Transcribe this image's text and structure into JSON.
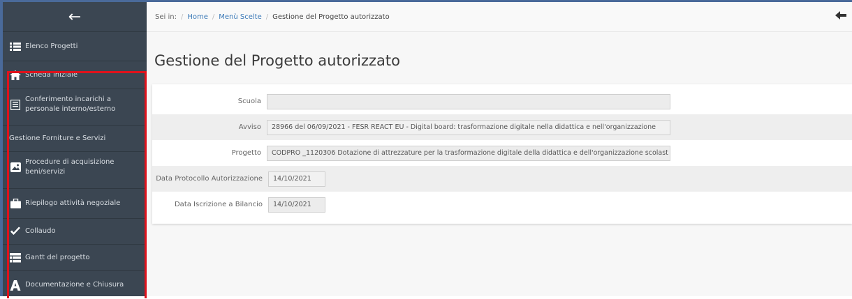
{
  "sidebar": {
    "back_glyph": "←",
    "items": [
      {
        "label": "Elenco Progetti",
        "icon": "list-icon"
      },
      {
        "label": "Scheda iniziale",
        "icon": "home-icon"
      },
      {
        "label": "Conferimento incarichi a personale interno/esterno",
        "icon": "document-icon"
      },
      {
        "label": "Gestione Forniture e Servizi",
        "icon": ""
      },
      {
        "label": "Procedure di acquisizione beni/servizi",
        "icon": "image-icon"
      },
      {
        "label": "Riepilogo attività negoziale",
        "icon": "briefcase-icon"
      },
      {
        "label": "Collaudo",
        "icon": "check-icon"
      },
      {
        "label": "Gantt del progetto",
        "icon": "table-icon"
      },
      {
        "label": "Documentazione e Chiusura",
        "icon": "font-icon"
      }
    ]
  },
  "breadcrumb": {
    "prefix": "Sei in:",
    "home": "Home",
    "menu": "Menù Scelte",
    "current": "Gestione del Progetto autorizzato"
  },
  "page": {
    "title": "Gestione del Progetto autorizzato"
  },
  "form": {
    "fields": [
      {
        "label": "Scuola",
        "value": ""
      },
      {
        "label": "Avviso",
        "value": "28966 del 06/09/2021 - FESR REACT EU - Digital board: trasformazione digitale nella didattica e nell'organizzazione"
      },
      {
        "label": "Progetto",
        "value": "CODPRO _1120306 Dotazione di attrezzature per la trasformazione digitale della didattica e dell'organizzazione scolast"
      },
      {
        "label": "Data Protocollo Autorizzazione",
        "value": "14/10/2021"
      },
      {
        "label": "Data Iscrizione a Bilancio",
        "value": "14/10/2021"
      }
    ]
  },
  "colors": {
    "sidebar_bg": "#3b4652",
    "highlight": "#e0121c",
    "link": "#3c7ab8"
  }
}
